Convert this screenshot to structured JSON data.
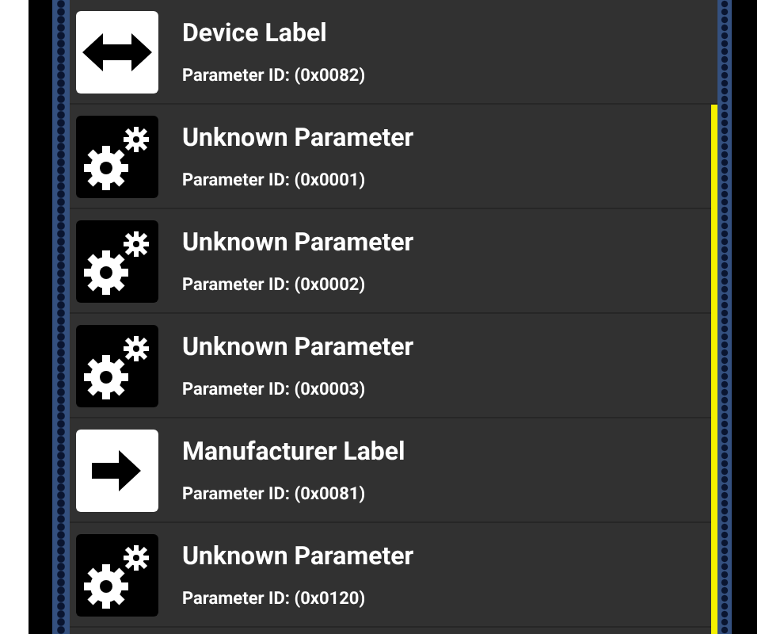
{
  "parameters": [
    {
      "kind": "device",
      "title": "Device Label",
      "subtitle": "Parameter ID: (0x0082)"
    },
    {
      "kind": "unknown",
      "title": "Unknown Parameter",
      "subtitle": "Parameter ID: (0x0001)"
    },
    {
      "kind": "unknown",
      "title": "Unknown Parameter",
      "subtitle": "Parameter ID: (0x0002)"
    },
    {
      "kind": "unknown",
      "title": "Unknown Parameter",
      "subtitle": "Parameter ID: (0x0003)"
    },
    {
      "kind": "manufacturer",
      "title": "Manufacturer Label",
      "subtitle": "Parameter ID: (0x0081)"
    },
    {
      "kind": "unknown",
      "title": "Unknown Parameter",
      "subtitle": "Parameter ID: (0x0120)"
    }
  ]
}
